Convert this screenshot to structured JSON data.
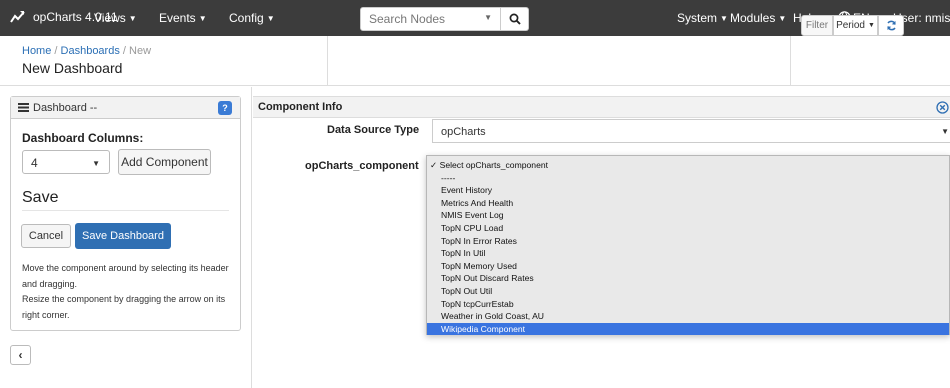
{
  "navbar": {
    "brand": "opCharts 4.0.11",
    "menus": {
      "views": "Views",
      "events": "Events",
      "config": "Config",
      "system": "System",
      "modules": "Modules",
      "help": "Help",
      "language": "EN",
      "user": "User: nmis"
    },
    "search": {
      "placeholder": "Search Nodes"
    }
  },
  "header": {
    "breadcrumb": {
      "home": "Home",
      "dashboards": "Dashboards",
      "current": "New"
    },
    "title": "New Dashboard",
    "filter_label": "Filter",
    "period_label": "Period"
  },
  "left_panel": {
    "title": "Dashboard --",
    "help_badge": "?",
    "columns_label": "Dashboard Columns:",
    "columns_value": "4",
    "add_component_label": "Add Component",
    "save_heading": "Save",
    "cancel_label": "Cancel",
    "save_dashboard_label": "Save Dashboard",
    "help_text": [
      "Move the component around by selecting its header",
      "and dragging.",
      "Resize the component by dragging the arrow on its",
      "right corner."
    ],
    "collapse_glyph": "‹"
  },
  "component_info": {
    "title": "Component Info",
    "data_source_label": "Data Source Type",
    "data_source_value": "opCharts",
    "component_label": "opCharts_component",
    "options": [
      "✓ Select opCharts_component",
      "-----",
      "Event History",
      "Metrics And Health",
      "NMIS Event Log",
      "TopN CPU Load",
      "TopN In Error Rates",
      "TopN In Util",
      "TopN Memory Used",
      "TopN Out Discard Rates",
      "TopN Out Util",
      "TopN tcpCurrEstab",
      "Weather in Gold Coast, AU",
      "Wikipedia Component"
    ],
    "selected_index": 13
  },
  "colors": {
    "navbar": "#3c3c3c",
    "primary_button": "#2f6fb3",
    "selected_option": "#3a74e0",
    "link": "#2b6fb5"
  }
}
